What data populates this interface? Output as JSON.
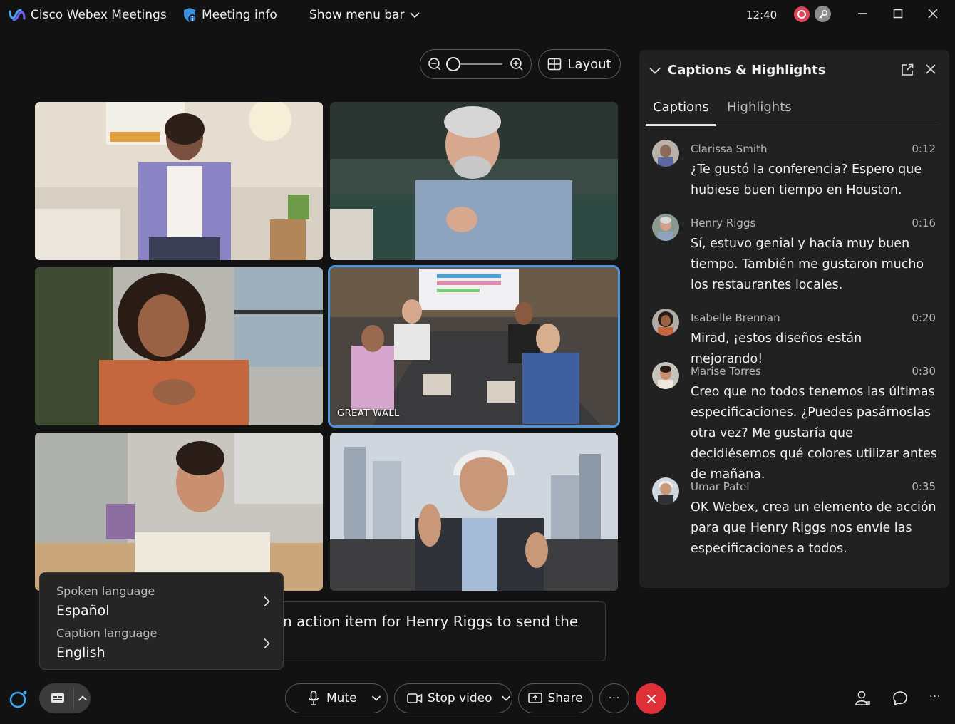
{
  "titlebar": {
    "app_name": "Cisco Webex Meetings",
    "meeting_info": "Meeting info",
    "show_menu_bar": "Show menu bar",
    "time": "12:40"
  },
  "toolbar_top": {
    "layout_label": "Layout",
    "zoom_level": 0
  },
  "video_tiles": [
    {
      "label": ""
    },
    {
      "label": ""
    },
    {
      "label": ""
    },
    {
      "label": "GREAT WALL"
    },
    {
      "label": ""
    },
    {
      "label": ""
    }
  ],
  "captions_panel": {
    "title": "Captions & Highlights",
    "tabs": [
      "Captions",
      "Highlights"
    ],
    "active_tab": "Captions",
    "entries": [
      {
        "name": "Clarissa Smith",
        "time": "0:12",
        "text": "¿Te gustó la conferencia? Espero que hubiese buen tiempo en Houston."
      },
      {
        "name": "Henry Riggs",
        "time": "0:16",
        "text": "Sí, estuvo genial y hacía muy buen tiempo. También me gustaron mucho los restaurantes locales."
      },
      {
        "name": "Isabelle Brennan",
        "time": "0:20",
        "text": "Mirad, ¡estos diseños están mejorando!"
      },
      {
        "name": "Marise Torres",
        "time": "0:30",
        "text": "Creo que no todos tenemos las últimas especificaciones. ¿Puedes pasárnoslas otra vez? Me gustaría que decidiésemos qué colores utilizar antes de mañana."
      },
      {
        "name": "Umar Patel",
        "time": "0:35",
        "text": "OK Webex, crea un elemento de acción para que Henry Riggs nos envíe las especificaciones a todos."
      }
    ]
  },
  "live_caption": {
    "text": "n action item for Henry Riggs to send the"
  },
  "language_menu": {
    "spoken_label": "Spoken language",
    "spoken_value": "Español",
    "caption_label": "Caption language",
    "caption_value": "English"
  },
  "controls": {
    "mute": "Mute",
    "stop_video": "Stop video",
    "share": "Share",
    "more": "···",
    "bottom_right_more": "···"
  },
  "colors": {
    "background": "#121212",
    "panel": "#212121",
    "end_call": "#e0303a",
    "active_tile_border": "#4c93d9",
    "recording": "#e0445c"
  },
  "icons": {
    "app": "webex-logo-icon",
    "meeting_info": "shield-info-icon",
    "end_call": "close-icon",
    "participants": "participants-icon",
    "chat": "chat-icon"
  }
}
